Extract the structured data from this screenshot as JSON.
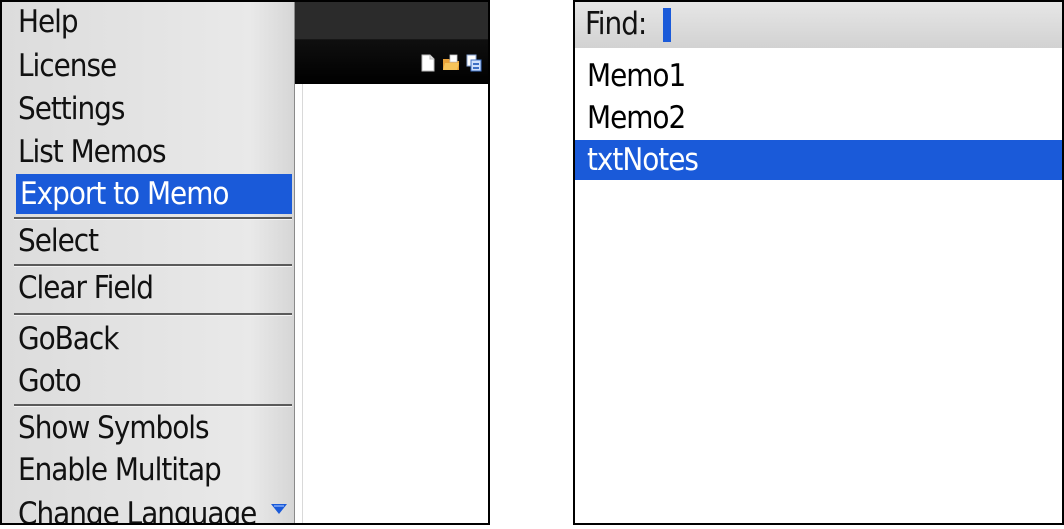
{
  "left_screen": {
    "menu": {
      "items": [
        {
          "label": "Help"
        },
        {
          "label": "License"
        },
        {
          "label": "Settings"
        },
        {
          "label": "List Memos"
        },
        {
          "label": "Export to Memo",
          "selected": true
        },
        {
          "label": "Select"
        },
        {
          "label": "Clear Field"
        },
        {
          "label": "GoBack"
        },
        {
          "label": "Goto"
        },
        {
          "label": "Show Symbols"
        },
        {
          "label": "Enable Multitap"
        },
        {
          "label": "Change Language"
        }
      ]
    },
    "toolbar": {
      "icons": [
        "new-document-icon",
        "open-folder-icon",
        "save-copy-icon"
      ]
    }
  },
  "right_screen": {
    "find": {
      "label": "Find:",
      "value": ""
    },
    "list": {
      "items": [
        {
          "label": "Memo1"
        },
        {
          "label": "Memo2"
        },
        {
          "label": "txtNotes",
          "selected": true
        }
      ]
    }
  },
  "colors": {
    "selection": "#1a5ad9",
    "menu_bg": "#e2e2e2",
    "toolbar_bg": "#1a1a1a"
  }
}
